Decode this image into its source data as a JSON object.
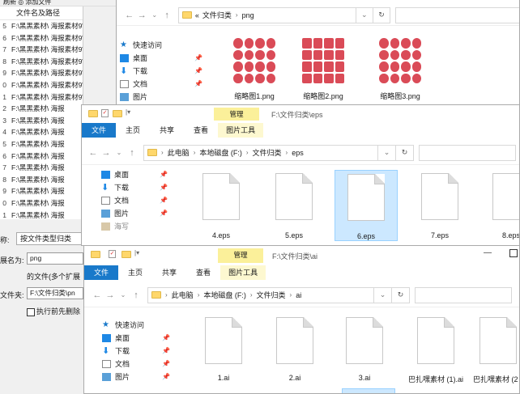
{
  "tool": {
    "toolbar_text": "刷新  ◎ 添加文件",
    "column_header": "文件名及路径",
    "rows": [
      {
        "idx": "5",
        "path": "F:\\黑黑素材\\ 海报素材9\\福禄"
      },
      {
        "idx": "6",
        "path": "F:\\黑黑素材\\ 海报素材9\\福禄"
      },
      {
        "idx": "7",
        "path": "F:\\黑黑素材\\ 海报素材9\\1. ai"
      },
      {
        "idx": "8",
        "path": "F:\\黑黑素材\\ 海报素材9\\1. jp"
      },
      {
        "idx": "9",
        "path": "F:\\黑黑素材\\ 海报素材9\\10. a"
      },
      {
        "idx": "0",
        "path": "F:\\黑黑素材\\ 海报素材9\\10. j"
      },
      {
        "idx": "1",
        "path": "F:\\黑黑素材\\ 海报素材9\\2. ai"
      },
      {
        "idx": "2",
        "path": "F:\\黑黑素材\\ 海报"
      },
      {
        "idx": "3",
        "path": "F:\\黑黑素材\\ 海报"
      },
      {
        "idx": "4",
        "path": "F:\\黑黑素材\\ 海报"
      },
      {
        "idx": "5",
        "path": "F:\\黑黑素材\\ 海报"
      },
      {
        "idx": "6",
        "path": "F:\\黑黑素材\\ 海报"
      },
      {
        "idx": "7",
        "path": "F:\\黑黑素材\\ 海报"
      },
      {
        "idx": "8",
        "path": "F:\\黑黑素材\\ 海报"
      },
      {
        "idx": "9",
        "path": "F:\\黑黑素材\\ 海报"
      },
      {
        "idx": "0",
        "path": "F:\\黑黑素材\\ 海报"
      },
      {
        "idx": "1",
        "path": "F:\\黑黑素材\\ 海报"
      }
    ],
    "name_label": "称:",
    "name_value": "按文件类型归类",
    "ext_label": "展名为:",
    "ext_value": "png",
    "ext_hint": "的文件(多个扩展",
    "folder_label": "文件夹:",
    "folder_value": "F:\\文件归类\\pn",
    "checkbox_label": "执行前先删除"
  },
  "win_png": {
    "address": [
      "«",
      "文件归类",
      "png"
    ],
    "sidebar": [
      {
        "label": "快速访问",
        "icon": "star-icon"
      },
      {
        "label": "桌面",
        "icon": "desktop-icon"
      },
      {
        "label": "下载",
        "icon": "download-icon"
      },
      {
        "label": "文档",
        "icon": "document-icon"
      },
      {
        "label": "图片",
        "icon": "picture-icon"
      }
    ],
    "files": [
      "缩略图1.png",
      "缩略图2.png",
      "缩略图3.png"
    ]
  },
  "win_eps": {
    "title": "F:\\文件归类\\eps",
    "manage_label": "管理",
    "tabs": [
      "文件",
      "主页",
      "共享",
      "查看"
    ],
    "picture_tools": "图片工具",
    "address": [
      "此电脑",
      "本地磁盘 (F:)",
      "文件归类",
      "eps"
    ],
    "sidebar": [
      {
        "label": "桌面",
        "icon": "desktop-icon"
      },
      {
        "label": "下载",
        "icon": "download-icon"
      },
      {
        "label": "文档",
        "icon": "document-icon"
      },
      {
        "label": "图片",
        "icon": "picture-icon"
      },
      {
        "label": "海写",
        "icon": "folder-icon"
      }
    ],
    "files": [
      "4.eps",
      "5.eps",
      "6.eps",
      "7.eps",
      "8.eps"
    ],
    "selected_file": "6.eps"
  },
  "win_ai": {
    "title": "F:\\文件归类\\ai",
    "manage_label": "管理",
    "tabs": [
      "文件",
      "主页",
      "共享",
      "查看"
    ],
    "picture_tools": "图片工具",
    "address": [
      "此电脑",
      "本地磁盘 (F:)",
      "文件归类",
      "ai"
    ],
    "sidebar": [
      {
        "label": "快速访问",
        "icon": "star-icon"
      },
      {
        "label": "桌面",
        "icon": "desktop-icon"
      },
      {
        "label": "下载",
        "icon": "download-icon"
      },
      {
        "label": "文档",
        "icon": "document-icon"
      },
      {
        "label": "图片",
        "icon": "picture-icon"
      }
    ],
    "files": [
      "1.ai",
      "2.ai",
      "3.ai",
      "巴扎嘿素材 (1).ai",
      "巴扎嘿素材 (2"
    ]
  },
  "colors": {
    "file_tab": "#1979ca",
    "manage": "#fbf09a",
    "selected": "#cce8ff",
    "folder": "#ffd76b",
    "thumb_red": "#d42c3a"
  }
}
